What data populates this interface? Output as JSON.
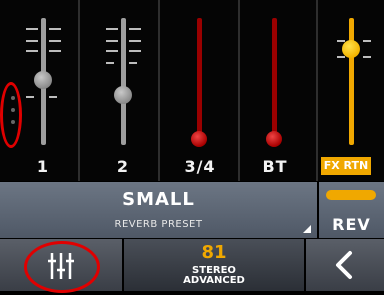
{
  "channels": [
    {
      "label": "1",
      "color": "#9e9e9e",
      "level": 0.52
    },
    {
      "label": "2",
      "color": "#9e9e9e",
      "level": 0.39
    },
    {
      "label": "3/4",
      "color": "#b00000",
      "level": 0.0
    },
    {
      "label": "BT",
      "color": "#b00000",
      "level": 0.0
    },
    {
      "label": "FX RTN",
      "color": "#f0a800",
      "level": 0.85
    }
  ],
  "preset": {
    "name": "SMALL",
    "subtitle": "REVERB PRESET"
  },
  "rev": {
    "label": "REV"
  },
  "value": {
    "number": "81",
    "line1": "STEREO",
    "line2": "ADVANCED"
  },
  "icons": {
    "mixer": "mixer-sliders-icon",
    "back": "chevron-left-icon"
  }
}
